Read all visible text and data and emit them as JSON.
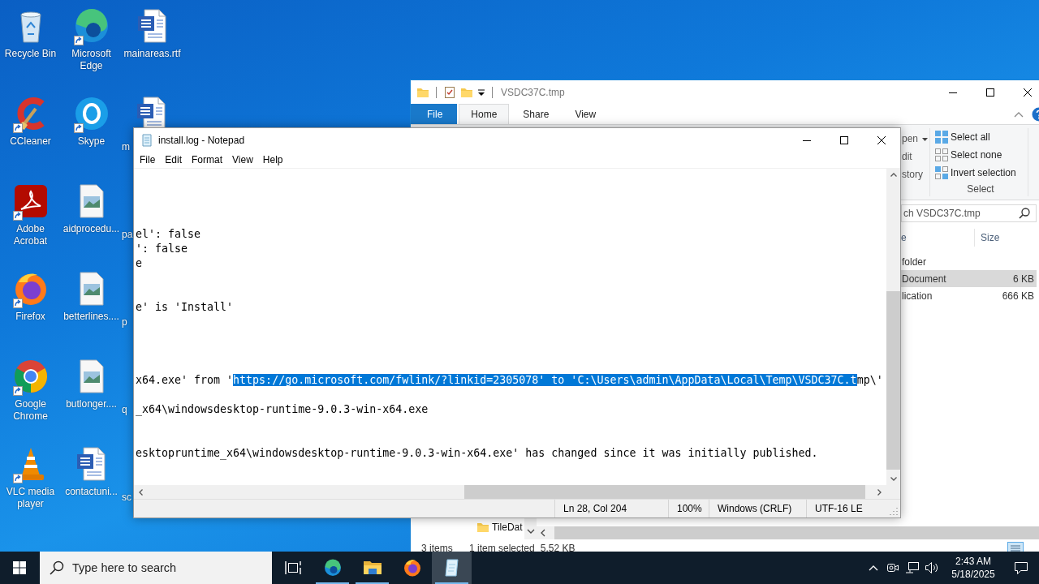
{
  "desktop_icons": [
    {
      "label": "Recycle Bin",
      "kind": "recycle-bin",
      "shortcut": false,
      "clipped": false
    },
    {
      "label": "CCleaner",
      "kind": "ccleaner",
      "shortcut": true,
      "clipped": false
    },
    {
      "label": "Adobe Acrobat",
      "kind": "acrobat",
      "shortcut": true,
      "clipped": false
    },
    {
      "label": "Firefox",
      "kind": "firefox",
      "shortcut": true,
      "clipped": false
    },
    {
      "label": "Google Chrome",
      "kind": "chrome",
      "shortcut": true,
      "clipped": false
    },
    {
      "label": "VLC media player",
      "kind": "vlc",
      "shortcut": true,
      "clipped": false
    },
    {
      "label": "Microsoft Edge",
      "kind": "edge",
      "shortcut": true,
      "clipped": false
    },
    {
      "label": "Skype",
      "kind": "skype",
      "shortcut": true,
      "clipped": false
    },
    {
      "label": "aidprocedu...",
      "kind": "image",
      "shortcut": false,
      "clipped": false
    },
    {
      "label": "betterlines....",
      "kind": "image",
      "shortcut": false,
      "clipped": false
    },
    {
      "label": "butlonger....",
      "kind": "image",
      "shortcut": false,
      "clipped": false
    },
    {
      "label": "contactuni...",
      "kind": "word",
      "shortcut": false,
      "clipped": false
    },
    {
      "label": "mainareas.rtf",
      "kind": "word",
      "shortcut": false,
      "clipped": false
    },
    {
      "label": "m",
      "kind": "word",
      "shortcut": false,
      "clipped": true
    },
    {
      "label": "pa",
      "shortcut": false,
      "clipped": true
    },
    {
      "label": "p",
      "shortcut": false,
      "clipped": true
    },
    {
      "label": "q",
      "shortcut": false,
      "clipped": true
    },
    {
      "label": "sc",
      "shortcut": false,
      "clipped": true
    }
  ],
  "explorer": {
    "title": "VSDC37C.tmp",
    "tabs": [
      {
        "label": "File",
        "kind": "file",
        "selected": false
      },
      {
        "label": "Home",
        "kind": "tab",
        "selected": true
      },
      {
        "label": "Share",
        "kind": "tab",
        "selected": false
      },
      {
        "label": "View",
        "kind": "tab",
        "selected": false
      }
    ],
    "open_group": [
      {
        "text": "pen",
        "dropdown": true
      },
      {
        "text": "dit",
        "dropdown": false
      },
      {
        "text": "story",
        "dropdown": false
      }
    ],
    "select_group": {
      "label": "Select",
      "items": [
        {
          "label": "Select all",
          "kind": "select-all"
        },
        {
          "label": "Select none",
          "kind": "select-none"
        },
        {
          "label": "Invert selection",
          "kind": "invert"
        }
      ]
    },
    "search": {
      "placeholder": "ch VSDC37C.tmp"
    },
    "columns": [
      "e",
      "Size"
    ],
    "files": [
      {
        "name": "folder",
        "selected": false
      },
      {
        "name": "Document",
        "size": "6 KB",
        "selected": true
      },
      {
        "name": "lication",
        "size": "666 KB",
        "selected": false
      }
    ],
    "nav_items": [
      {
        "label": "TileDat"
      }
    ],
    "status": {
      "items_count": "3 items",
      "selection": "1 item selected",
      "selection_size": "5.52 KB"
    }
  },
  "notepad": {
    "title": "install.log - Notepad",
    "menu": [
      "File",
      "Edit",
      "Format",
      "View",
      "Help"
    ],
    "lines": [
      {
        "kind": "blank"
      },
      {
        "kind": "blank"
      },
      {
        "kind": "blank"
      },
      {
        "kind": "blank"
      },
      {
        "kind": "text",
        "text": "el': false"
      },
      {
        "kind": "text",
        "text": "': false"
      },
      {
        "kind": "text",
        "text": "e"
      },
      {
        "kind": "blank"
      },
      {
        "kind": "blank"
      },
      {
        "kind": "text",
        "text": "e' is 'Install'"
      },
      {
        "kind": "blank"
      },
      {
        "kind": "blank"
      },
      {
        "kind": "blank"
      },
      {
        "kind": "blank"
      },
      {
        "kind": "selection",
        "text_before": "x64.exe' from '",
        "selected_text": "https://go.microsoft.com/fwlink/?linkid=2305078' to 'C:\\Users\\admin\\AppData\\Local\\Temp\\VSDC37C.t",
        "text_after": "mp\\'"
      },
      {
        "kind": "blank"
      },
      {
        "kind": "text",
        "text": "_x64\\windowsdesktop-runtime-9.0.3-win-x64.exe"
      },
      {
        "kind": "blank"
      },
      {
        "kind": "blank"
      },
      {
        "kind": "text",
        "text": "esktopruntime_x64\\windowsdesktop-runtime-9.0.3-win-x64.exe' has changed since it was initially published."
      }
    ],
    "status": [
      "Ln 28, Col 204",
      "100%",
      "Windows (CRLF)",
      "UTF-16 LE"
    ]
  },
  "taskbar": {
    "search_placeholder": "Type here to search",
    "apps": [
      {
        "kind": "edge",
        "running": true,
        "selected": false
      },
      {
        "kind": "folder",
        "running": true,
        "selected": false
      },
      {
        "kind": "firefox",
        "running": false,
        "selected": false
      },
      {
        "kind": "notepad",
        "running": true,
        "selected": true
      }
    ],
    "time": "2:43 AM",
    "date": "5/18/2025"
  }
}
